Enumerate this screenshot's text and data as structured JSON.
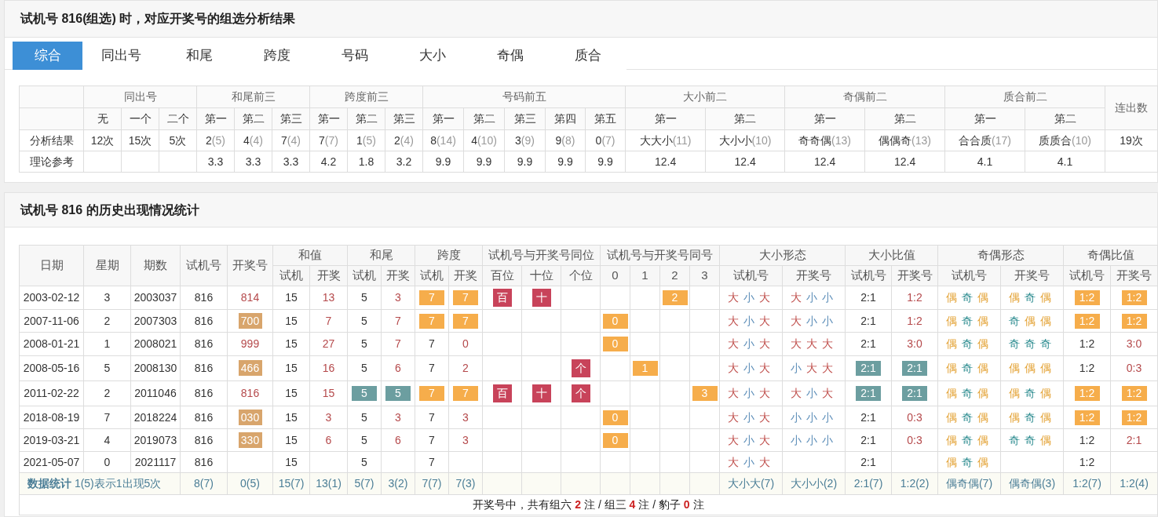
{
  "analysis": {
    "title": "试机号 816(组选) 时，对应开奖号的组选分析结果",
    "tabs": [
      {
        "label": "综合",
        "selected": true
      },
      {
        "label": "同出号",
        "selected": false
      },
      {
        "label": "和尾",
        "selected": false
      },
      {
        "label": "跨度",
        "selected": false
      },
      {
        "label": "号码",
        "selected": false
      },
      {
        "label": "大小",
        "selected": false
      },
      {
        "label": "奇偶",
        "selected": false
      },
      {
        "label": "质合",
        "selected": false
      }
    ],
    "table": {
      "groups": [
        {
          "label": "同出号",
          "subs": [
            "无",
            "一个",
            "二个"
          ]
        },
        {
          "label": "和尾前三",
          "subs": [
            "第一",
            "第二",
            "第三"
          ]
        },
        {
          "label": "跨度前三",
          "subs": [
            "第一",
            "第二",
            "第三"
          ]
        },
        {
          "label": "号码前五",
          "subs": [
            "第一",
            "第二",
            "第三",
            "第四",
            "第五"
          ]
        },
        {
          "label": "大小前二",
          "subs": [
            "第一",
            "第二"
          ]
        },
        {
          "label": "奇偶前二",
          "subs": [
            "第一",
            "第二"
          ]
        },
        {
          "label": "质合前二",
          "subs": [
            "第一",
            "第二"
          ]
        }
      ],
      "last_column": "连出数",
      "rows": [
        {
          "label": "分析结果",
          "cells": [
            "12次",
            "15次",
            "5次",
            {
              "text": "2",
              "note": "(5)"
            },
            {
              "text": "4",
              "note": "(4)"
            },
            {
              "text": "7",
              "note": "(4)"
            },
            {
              "text": "7",
              "note": "(7)"
            },
            {
              "text": "1",
              "note": "(5)"
            },
            {
              "text": "2",
              "note": "(4)"
            },
            {
              "text": "8",
              "note": "(14)"
            },
            {
              "text": "4",
              "note": "(10)"
            },
            {
              "text": "3",
              "note": "(9)"
            },
            {
              "text": "9",
              "note": "(8)"
            },
            {
              "text": "0",
              "note": "(7)"
            },
            {
              "text": "大大小",
              "note": "(11)"
            },
            {
              "text": "大小小",
              "note": "(10)"
            },
            {
              "text": "奇奇偶",
              "note": "(13)"
            },
            {
              "text": "偶偶奇",
              "note": "(13)"
            },
            {
              "text": "合合质",
              "note": "(17)"
            },
            {
              "text": "质质合",
              "note": "(10)"
            },
            "19次"
          ]
        },
        {
          "label": "理论参考",
          "cells": [
            null,
            null,
            null,
            "3.3",
            "3.3",
            "3.3",
            "4.2",
            "1.8",
            "3.2",
            "9.9",
            "9.9",
            "9.9",
            "9.9",
            "9.9",
            "12.4",
            "12.4",
            "12.4",
            "12.4",
            "4.1",
            "4.1",
            null
          ]
        }
      ]
    }
  },
  "history": {
    "title": "试机号 816 的历史出现情况统计",
    "table": {
      "headers": [
        {
          "label": "日期"
        },
        {
          "label": "星期"
        },
        {
          "label": "期数"
        },
        {
          "label": "试机号"
        },
        {
          "label": "开奖号"
        },
        {
          "label": "和值",
          "subs": [
            "试机",
            "开奖"
          ]
        },
        {
          "label": "和尾",
          "subs": [
            "试机",
            "开奖"
          ]
        },
        {
          "label": "跨度",
          "subs": [
            "试机",
            "开奖"
          ]
        },
        {
          "label": "试机号与开奖号同位",
          "subs": [
            "百位",
            "十位",
            "个位"
          ]
        },
        {
          "label": "试机号与开奖号同号",
          "subs": [
            "0",
            "1",
            "2",
            "3"
          ]
        },
        {
          "label": "大小形态",
          "subs": [
            "试机号",
            "开奖号"
          ]
        },
        {
          "label": "大小比值",
          "subs": [
            "试机号",
            "开奖号"
          ]
        },
        {
          "label": "奇偶形态",
          "subs": [
            "试机号",
            "开奖号"
          ]
        },
        {
          "label": "奇偶比值",
          "subs": [
            "试机号",
            "开奖号"
          ]
        }
      ],
      "rows": [
        {
          "cells": [
            "2003-02-12",
            "3",
            "2003037",
            "816",
            {
              "text": "814",
              "kind": "red"
            },
            "15",
            {
              "text": "13",
              "kind": "red"
            },
            "5",
            {
              "text": "3",
              "kind": "red"
            },
            {
              "text": "7",
              "kind": "orange"
            },
            {
              "text": "7",
              "kind": "orange"
            },
            {
              "text": "百",
              "kind": "crimson"
            },
            {
              "text": "十",
              "kind": "crimson"
            },
            null,
            null,
            null,
            {
              "text": "2",
              "kind": "orange"
            },
            null,
            {
              "chars": [
                {
                  "text": "大",
                  "kind": "big"
                },
                {
                  "text": "小",
                  "kind": "small"
                },
                {
                  "text": "大",
                  "kind": "big"
                }
              ]
            },
            {
              "chars": [
                {
                  "text": "大",
                  "kind": "big"
                },
                {
                  "text": "小",
                  "kind": "small"
                },
                {
                  "text": "小",
                  "kind": "small"
                }
              ]
            },
            "2:1",
            {
              "text": "1:2",
              "kind": "red"
            },
            {
              "chars": [
                {
                  "text": "偶",
                  "kind": "even"
                },
                {
                  "text": "奇",
                  "kind": "odd"
                },
                {
                  "text": "偶",
                  "kind": "even"
                }
              ]
            },
            {
              "chars": [
                {
                  "text": "偶",
                  "kind": "even"
                },
                {
                  "text": "奇",
                  "kind": "odd"
                },
                {
                  "text": "偶",
                  "kind": "even"
                }
              ]
            },
            {
              "text": "1:2",
              "kind": "orange"
            },
            {
              "text": "1:2",
              "kind": "orange"
            }
          ]
        },
        {
          "cells": [
            "2007-11-06",
            "2",
            "2007303",
            "816",
            {
              "text": "700",
              "kind": "tan"
            },
            "15",
            {
              "text": "7",
              "kind": "red"
            },
            "5",
            {
              "text": "7",
              "kind": "red"
            },
            {
              "text": "7",
              "kind": "orange"
            },
            {
              "text": "7",
              "kind": "orange"
            },
            null,
            null,
            null,
            {
              "text": "0",
              "kind": "orange"
            },
            null,
            null,
            null,
            {
              "chars": [
                {
                  "text": "大",
                  "kind": "big"
                },
                {
                  "text": "小",
                  "kind": "small"
                },
                {
                  "text": "大",
                  "kind": "big"
                }
              ]
            },
            {
              "chars": [
                {
                  "text": "大",
                  "kind": "big"
                },
                {
                  "text": "小",
                  "kind": "small"
                },
                {
                  "text": "小",
                  "kind": "small"
                }
              ]
            },
            "2:1",
            {
              "text": "1:2",
              "kind": "red"
            },
            {
              "chars": [
                {
                  "text": "偶",
                  "kind": "even"
                },
                {
                  "text": "奇",
                  "kind": "odd"
                },
                {
                  "text": "偶",
                  "kind": "even"
                }
              ]
            },
            {
              "chars": [
                {
                  "text": "奇",
                  "kind": "odd"
                },
                {
                  "text": "偶",
                  "kind": "even"
                },
                {
                  "text": "偶",
                  "kind": "even"
                }
              ]
            },
            {
              "text": "1:2",
              "kind": "orange"
            },
            {
              "text": "1:2",
              "kind": "orange"
            }
          ]
        },
        {
          "cells": [
            "2008-01-21",
            "1",
            "2008021",
            "816",
            {
              "text": "999",
              "kind": "red"
            },
            "15",
            {
              "text": "27",
              "kind": "red"
            },
            "5",
            {
              "text": "7",
              "kind": "red"
            },
            "7",
            {
              "text": "0",
              "kind": "red"
            },
            null,
            null,
            null,
            {
              "text": "0",
              "kind": "orange"
            },
            null,
            null,
            null,
            {
              "chars": [
                {
                  "text": "大",
                  "kind": "big"
                },
                {
                  "text": "小",
                  "kind": "small"
                },
                {
                  "text": "大",
                  "kind": "big"
                }
              ]
            },
            {
              "chars": [
                {
                  "text": "大",
                  "kind": "big"
                },
                {
                  "text": "大",
                  "kind": "big"
                },
                {
                  "text": "大",
                  "kind": "big"
                }
              ]
            },
            "2:1",
            {
              "text": "3:0",
              "kind": "red"
            },
            {
              "chars": [
                {
                  "text": "偶",
                  "kind": "even"
                },
                {
                  "text": "奇",
                  "kind": "odd"
                },
                {
                  "text": "偶",
                  "kind": "even"
                }
              ]
            },
            {
              "chars": [
                {
                  "text": "奇",
                  "kind": "odd"
                },
                {
                  "text": "奇",
                  "kind": "odd"
                },
                {
                  "text": "奇",
                  "kind": "odd"
                }
              ]
            },
            "1:2",
            {
              "text": "3:0",
              "kind": "red"
            }
          ]
        },
        {
          "cells": [
            "2008-05-16",
            "5",
            "2008130",
            "816",
            {
              "text": "466",
              "kind": "tan"
            },
            "15",
            {
              "text": "16",
              "kind": "red"
            },
            "5",
            {
              "text": "6",
              "kind": "red"
            },
            "7",
            {
              "text": "2",
              "kind": "red"
            },
            null,
            null,
            {
              "text": "个",
              "kind": "crimson"
            },
            null,
            {
              "text": "1",
              "kind": "orange"
            },
            null,
            null,
            {
              "chars": [
                {
                  "text": "大",
                  "kind": "big"
                },
                {
                  "text": "小",
                  "kind": "small"
                },
                {
                  "text": "大",
                  "kind": "big"
                }
              ]
            },
            {
              "chars": [
                {
                  "text": "小",
                  "kind": "small"
                },
                {
                  "text": "大",
                  "kind": "big"
                },
                {
                  "text": "大",
                  "kind": "big"
                }
              ]
            },
            {
              "text": "2:1",
              "kind": "teal"
            },
            {
              "text": "2:1",
              "kind": "teal"
            },
            {
              "chars": [
                {
                  "text": "偶",
                  "kind": "even"
                },
                {
                  "text": "奇",
                  "kind": "odd"
                },
                {
                  "text": "偶",
                  "kind": "even"
                }
              ]
            },
            {
              "chars": [
                {
                  "text": "偶",
                  "kind": "even"
                },
                {
                  "text": "偶",
                  "kind": "even"
                },
                {
                  "text": "偶",
                  "kind": "even"
                }
              ]
            },
            "1:2",
            {
              "text": "0:3",
              "kind": "red"
            }
          ]
        },
        {
          "cells": [
            "2011-02-22",
            "2",
            "2011046",
            "816",
            {
              "text": "816",
              "kind": "red"
            },
            "15",
            {
              "text": "15",
              "kind": "red"
            },
            {
              "text": "5",
              "kind": "teal"
            },
            {
              "text": "5",
              "kind": "teal"
            },
            {
              "text": "7",
              "kind": "orange"
            },
            {
              "text": "7",
              "kind": "orange"
            },
            {
              "text": "百",
              "kind": "crimson"
            },
            {
              "text": "十",
              "kind": "crimson"
            },
            {
              "text": "个",
              "kind": "crimson"
            },
            null,
            null,
            null,
            {
              "text": "3",
              "kind": "orange"
            },
            {
              "chars": [
                {
                  "text": "大",
                  "kind": "big"
                },
                {
                  "text": "小",
                  "kind": "small"
                },
                {
                  "text": "大",
                  "kind": "big"
                }
              ]
            },
            {
              "chars": [
                {
                  "text": "大",
                  "kind": "big"
                },
                {
                  "text": "小",
                  "kind": "small"
                },
                {
                  "text": "大",
                  "kind": "big"
                }
              ]
            },
            {
              "text": "2:1",
              "kind": "teal"
            },
            {
              "text": "2:1",
              "kind": "teal"
            },
            {
              "chars": [
                {
                  "text": "偶",
                  "kind": "even"
                },
                {
                  "text": "奇",
                  "kind": "odd"
                },
                {
                  "text": "偶",
                  "kind": "even"
                }
              ]
            },
            {
              "chars": [
                {
                  "text": "偶",
                  "kind": "even"
                },
                {
                  "text": "奇",
                  "kind": "odd"
                },
                {
                  "text": "偶",
                  "kind": "even"
                }
              ]
            },
            {
              "text": "1:2",
              "kind": "orange"
            },
            {
              "text": "1:2",
              "kind": "orange"
            }
          ]
        },
        {
          "cells": [
            "2018-08-19",
            "7",
            "2018224",
            "816",
            {
              "text": "030",
              "kind": "tan"
            },
            "15",
            {
              "text": "3",
              "kind": "red"
            },
            "5",
            {
              "text": "3",
              "kind": "red"
            },
            "7",
            {
              "text": "3",
              "kind": "red"
            },
            null,
            null,
            null,
            {
              "text": "0",
              "kind": "orange"
            },
            null,
            null,
            null,
            {
              "chars": [
                {
                  "text": "大",
                  "kind": "big"
                },
                {
                  "text": "小",
                  "kind": "small"
                },
                {
                  "text": "大",
                  "kind": "big"
                }
              ]
            },
            {
              "chars": [
                {
                  "text": "小",
                  "kind": "small"
                },
                {
                  "text": "小",
                  "kind": "small"
                },
                {
                  "text": "小",
                  "kind": "small"
                }
              ]
            },
            "2:1",
            {
              "text": "0:3",
              "kind": "red"
            },
            {
              "chars": [
                {
                  "text": "偶",
                  "kind": "even"
                },
                {
                  "text": "奇",
                  "kind": "odd"
                },
                {
                  "text": "偶",
                  "kind": "even"
                }
              ]
            },
            {
              "chars": [
                {
                  "text": "偶",
                  "kind": "even"
                },
                {
                  "text": "奇",
                  "kind": "odd"
                },
                {
                  "text": "偶",
                  "kind": "even"
                }
              ]
            },
            {
              "text": "1:2",
              "kind": "orange"
            },
            {
              "text": "1:2",
              "kind": "orange"
            }
          ]
        },
        {
          "cells": [
            "2019-03-21",
            "4",
            "2019073",
            "816",
            {
              "text": "330",
              "kind": "tan"
            },
            "15",
            {
              "text": "6",
              "kind": "red"
            },
            "5",
            {
              "text": "6",
              "kind": "red"
            },
            "7",
            {
              "text": "3",
              "kind": "red"
            },
            null,
            null,
            null,
            {
              "text": "0",
              "kind": "orange"
            },
            null,
            null,
            null,
            {
              "chars": [
                {
                  "text": "大",
                  "kind": "big"
                },
                {
                  "text": "小",
                  "kind": "small"
                },
                {
                  "text": "大",
                  "kind": "big"
                }
              ]
            },
            {
              "chars": [
                {
                  "text": "小",
                  "kind": "small"
                },
                {
                  "text": "小",
                  "kind": "small"
                },
                {
                  "text": "小",
                  "kind": "small"
                }
              ]
            },
            "2:1",
            {
              "text": "0:3",
              "kind": "red"
            },
            {
              "chars": [
                {
                  "text": "偶",
                  "kind": "even"
                },
                {
                  "text": "奇",
                  "kind": "odd"
                },
                {
                  "text": "偶",
                  "kind": "even"
                }
              ]
            },
            {
              "chars": [
                {
                  "text": "奇",
                  "kind": "odd"
                },
                {
                  "text": "奇",
                  "kind": "odd"
                },
                {
                  "text": "偶",
                  "kind": "even"
                }
              ]
            },
            "1:2",
            {
              "text": "2:1",
              "kind": "red"
            }
          ]
        },
        {
          "cells": [
            "2021-05-07",
            "0",
            "2021117",
            "816",
            null,
            "15",
            null,
            "5",
            null,
            "7",
            null,
            null,
            null,
            null,
            null,
            null,
            null,
            null,
            {
              "chars": [
                {
                  "text": "大",
                  "kind": "big"
                },
                {
                  "text": "小",
                  "kind": "small"
                },
                {
                  "text": "大",
                  "kind": "big"
                }
              ]
            },
            null,
            "2:1",
            null,
            {
              "chars": [
                {
                  "text": "偶",
                  "kind": "even"
                },
                {
                  "text": "奇",
                  "kind": "odd"
                },
                {
                  "text": "偶",
                  "kind": "even"
                }
              ]
            },
            null,
            "1:2",
            null
          ]
        }
      ],
      "stats_row": {
        "label": "**数据统计** 1(5)表示1出现5次",
        "cells": [
          "8(7)",
          "0(5)",
          "15(7)",
          "13(1)",
          "5(7)",
          "3(2)",
          "7(7)",
          "7(3)",
          null,
          null,
          null,
          null,
          null,
          null,
          null,
          "大小大(7)",
          "大小小(2)",
          "2:1(7)",
          "1:2(2)",
          "偶奇偶(7)",
          "偶奇偶(3)",
          "1:2(7)",
          "1:2(4)"
        ]
      },
      "footer": "开奖号中，共有组六 **2** 注 / 组三 **4** 注 / 豹子 **0** 注"
    }
  }
}
